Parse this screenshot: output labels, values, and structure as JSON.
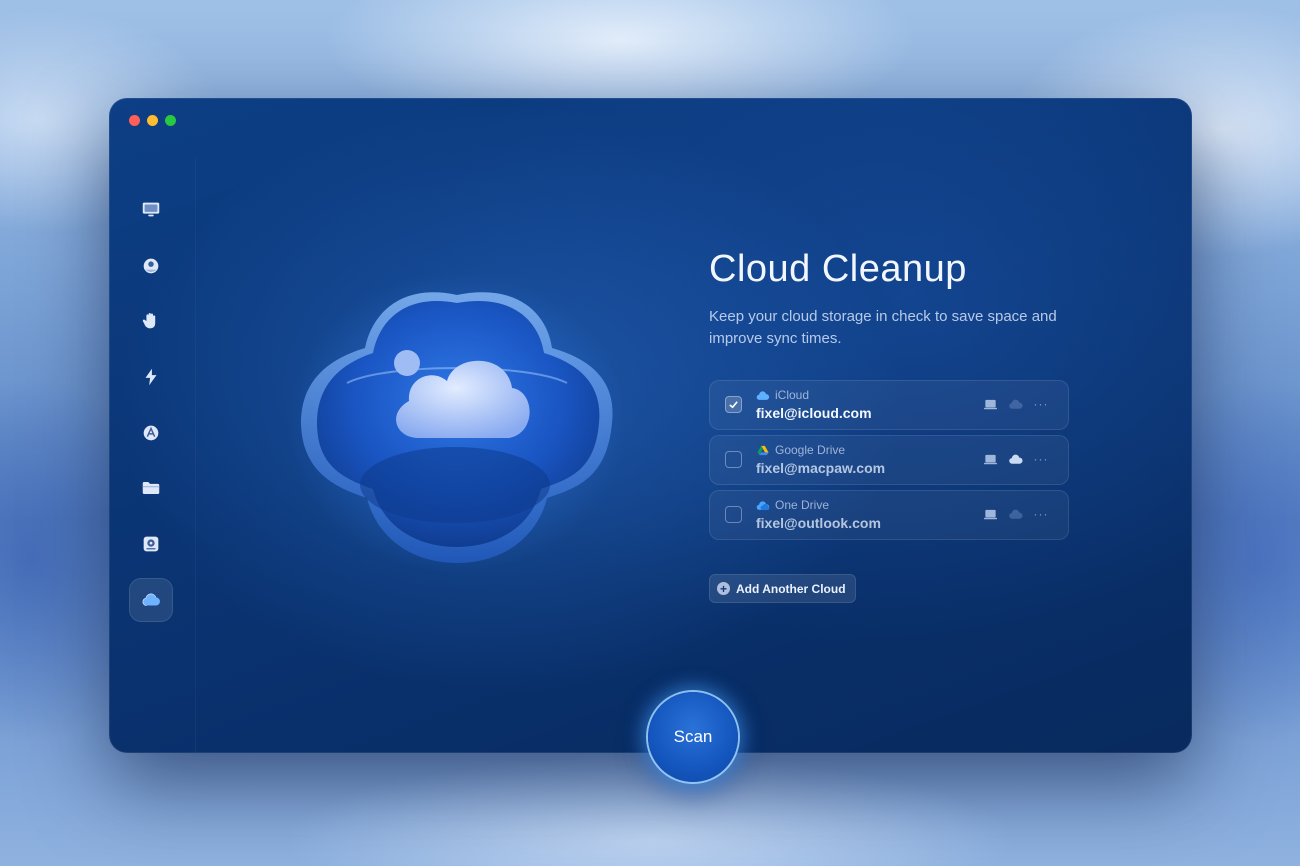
{
  "window": {
    "title": "Cloud Cleanup",
    "subtitle": "Keep your cloud storage in check to save space and improve sync times."
  },
  "sidebar": {
    "items": [
      {
        "icon": "monitor-icon",
        "active": false
      },
      {
        "icon": "shield-icon",
        "active": false
      },
      {
        "icon": "hand-icon",
        "active": false
      },
      {
        "icon": "lightning-icon",
        "active": false
      },
      {
        "icon": "applications-icon",
        "active": false
      },
      {
        "icon": "folder-icon",
        "active": false
      },
      {
        "icon": "disk-icon",
        "active": false
      },
      {
        "icon": "cloud-icon",
        "active": true
      }
    ],
    "bottom_icon": "assistant-icon"
  },
  "clouds": [
    {
      "provider": "iCloud",
      "email": "fixel@icloud.com",
      "checked": true,
      "provider_icon": "icloud-icon"
    },
    {
      "provider": "Google Drive",
      "email": "fixel@macpaw.com",
      "checked": false,
      "provider_icon": "google-drive-icon"
    },
    {
      "provider": "One Drive",
      "email": "fixel@outlook.com",
      "checked": false,
      "provider_icon": "onedrive-icon"
    }
  ],
  "more_label": "···",
  "add_button_label": "Add Another Cloud",
  "scan_label": "Scan",
  "colors": {
    "accent": "#1558c0",
    "window_bg": "#0a3473"
  }
}
